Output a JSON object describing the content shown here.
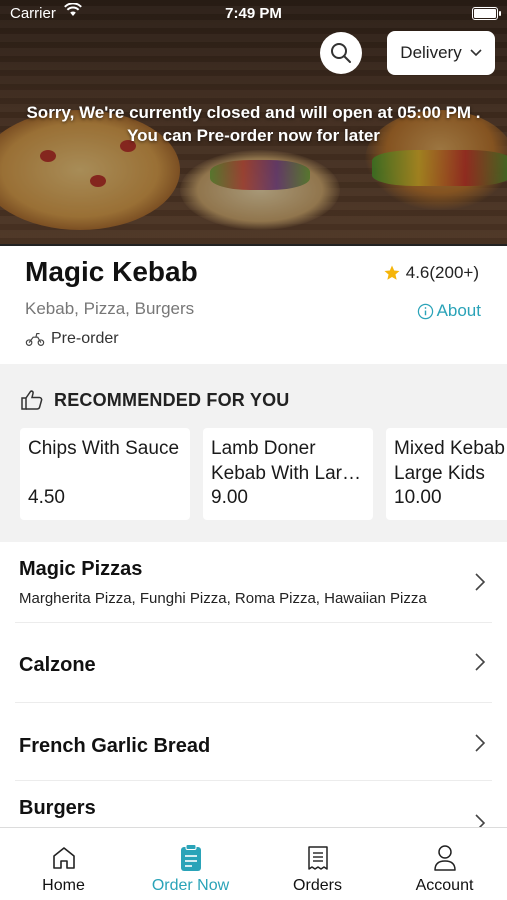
{
  "status_bar": {
    "carrier": "Carrier",
    "time": "7:49 PM"
  },
  "header": {
    "delivery_mode": "Delivery",
    "closed_message_line1": "Sorry, We're currently closed and will open at 05:00 PM .",
    "closed_message_line2": "You can Pre-order now for later"
  },
  "restaurant": {
    "name": "Magic Kebab",
    "rating": "4.6(200+)",
    "cuisines": "Kebab, Pizza, Burgers",
    "about_label": "About",
    "preorder_label": "Pre-order"
  },
  "recommended": {
    "heading": "RECOMMENDED FOR YOU",
    "items": [
      {
        "title": "Chips With Sauce",
        "price": "4.50"
      },
      {
        "title": "Lamb Doner Kebab With Large Kebab Naan",
        "price": "9.00"
      },
      {
        "title": "Mixed Kebab On Large Kids",
        "price": "10.00"
      }
    ]
  },
  "categories": [
    {
      "name": "Magic Pizzas",
      "description": "Margherita Pizza, Funghi Pizza, Roma Pizza, Hawaiian Pizza"
    },
    {
      "name": "Calzone",
      "description": ""
    },
    {
      "name": "French Garlic Bread",
      "description": ""
    },
    {
      "name": "Burgers",
      "description": ""
    }
  ],
  "tabs": [
    {
      "label": "Home",
      "icon": "home-icon",
      "active": false
    },
    {
      "label": "Order Now",
      "icon": "order-icon",
      "active": true
    },
    {
      "label": "Orders",
      "icon": "receipt-icon",
      "active": false
    },
    {
      "label": "Account",
      "icon": "person-icon",
      "active": false
    }
  ],
  "colors": {
    "accent": "#2aa3b8",
    "star": "#f5b50a",
    "text": "#1a1a1a",
    "muted": "#777777"
  }
}
